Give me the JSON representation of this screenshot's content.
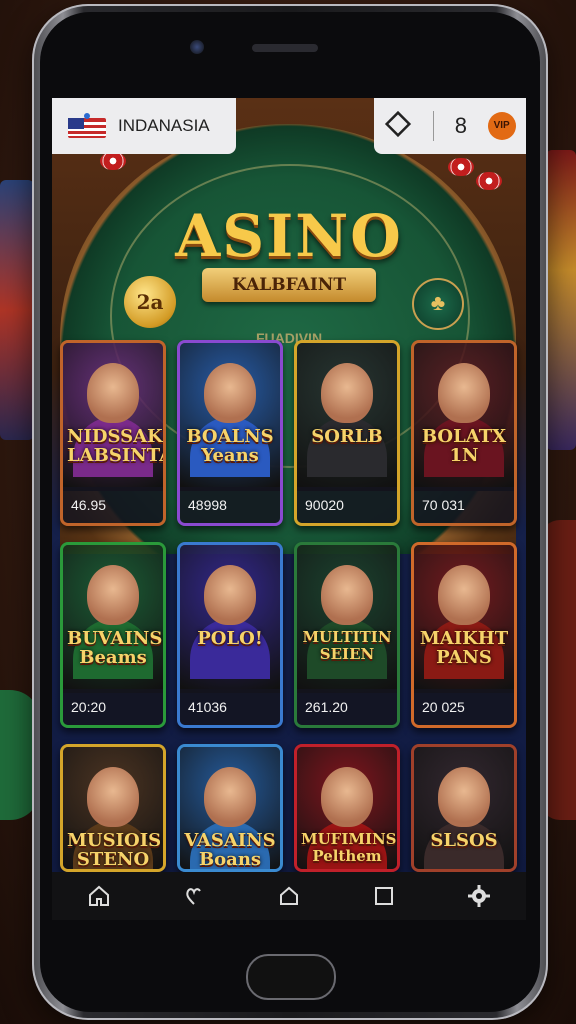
{
  "status_bar": {
    "region_label": "INDANASIA",
    "count": "8",
    "badge_icon": "vip-badge-icon"
  },
  "banner": {
    "title": "ASINO",
    "subtitle": "KALBFAINT",
    "coin_left": "2a",
    "tagline": "FUADIVIN"
  },
  "games": [
    {
      "name": "NIDSSAK",
      "sub": "LABSINTAL",
      "value": "46.95",
      "theme": "#7a2a8a",
      "border": "#c0642a"
    },
    {
      "name": "BOALNS",
      "sub": "Yeans",
      "value": "48998",
      "theme": "#2a5ac0",
      "border": "#8a4ad0"
    },
    {
      "name": "SORLB",
      "sub": "",
      "value": "90020",
      "theme": "#2a2a2e",
      "border": "#d4a52a"
    },
    {
      "name": "BOLATX",
      "sub": "1N",
      "value": "70 031",
      "theme": "#6a1420",
      "border": "#c0642a"
    },
    {
      "name": "BUVAINS",
      "sub": "Beams",
      "value": "20:20",
      "theme": "#1e6a30",
      "border": "#2a9a3a"
    },
    {
      "name": "POLO!",
      "sub": "",
      "value": "41036",
      "theme": "#3a2a9a",
      "border": "#3a7ad0"
    },
    {
      "name": "MULTITIN",
      "sub": "SEIEN",
      "value": "261.20",
      "theme": "#1e4a28",
      "border": "#2a7a3a"
    },
    {
      "name": "MAIKHT",
      "sub": "PANS",
      "value": "20 025",
      "theme": "#8a1a14",
      "border": "#d06a2a"
    },
    {
      "name": "MUSIOIS",
      "sub": "STENO",
      "value": "",
      "theme": "#5a3a1a",
      "border": "#d4a52a"
    },
    {
      "name": "VASAINS",
      "sub": "Boans",
      "value": "",
      "theme": "#2a6ab0",
      "border": "#3a8ad0"
    },
    {
      "name": "MUFIMINS",
      "sub": "Pelthem",
      "value": "",
      "theme": "#9a1414",
      "border": "#c0202a"
    },
    {
      "name": "SLSOS",
      "sub": "",
      "value": "",
      "theme": "#3a2a2a",
      "border": "#a0402a"
    }
  ],
  "navbar": {
    "items": [
      "home-icon",
      "heart-icon",
      "house-icon",
      "square-icon",
      "gear-icon"
    ]
  }
}
